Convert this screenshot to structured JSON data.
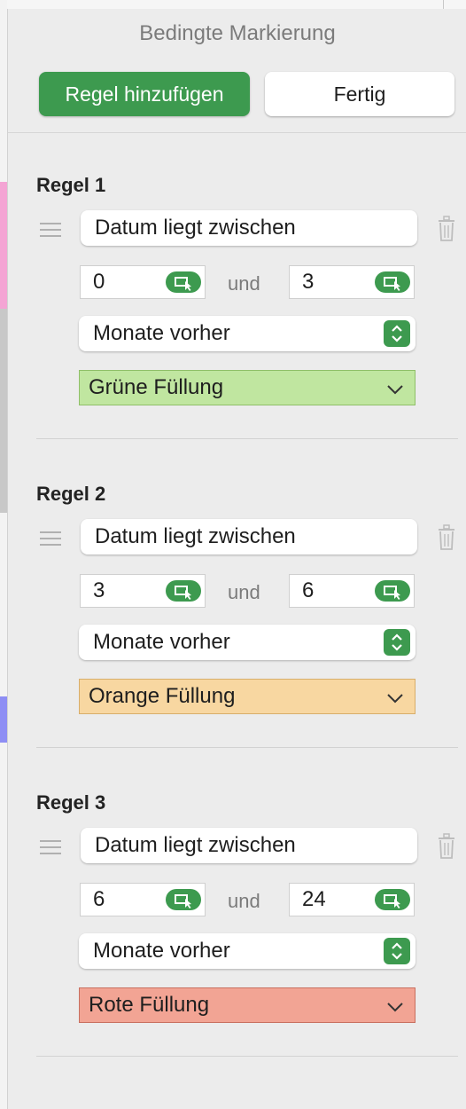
{
  "panel": {
    "title": "Bedingte Markierung",
    "add_rule_label": "Regel hinzufügen",
    "done_label": "Fertig"
  },
  "connector_label": "und",
  "rules": [
    {
      "title": "Regel 1",
      "condition": "Datum liegt zwischen",
      "value_from": "0",
      "value_to": "3",
      "unit": "Monate vorher",
      "fill_label": "Grüne Füllung",
      "fill_bg": "#c0e6a0",
      "fill_border": "#8fbf68"
    },
    {
      "title": "Regel 2",
      "condition": "Datum liegt zwischen",
      "value_from": "3",
      "value_to": "6",
      "unit": "Monate vorher",
      "fill_label": "Orange Füllung",
      "fill_bg": "#f8d7a1",
      "fill_border": "#d8ae6a"
    },
    {
      "title": "Regel 3",
      "condition": "Datum liegt zwischen",
      "value_from": "6",
      "value_to": "24",
      "unit": "Monate vorher",
      "fill_label": "Rote Füllung",
      "fill_bg": "#f2a494",
      "fill_border": "#c87060"
    }
  ],
  "colors": {
    "accent_green": "#3d9a4f"
  },
  "icons": {
    "drag_handle": "drag-handle-icon",
    "trash": "trash-icon",
    "cell_reference": "cell-reference-icon",
    "stepper": "up-down-stepper-icon",
    "dropdown": "chevron-down-icon"
  }
}
